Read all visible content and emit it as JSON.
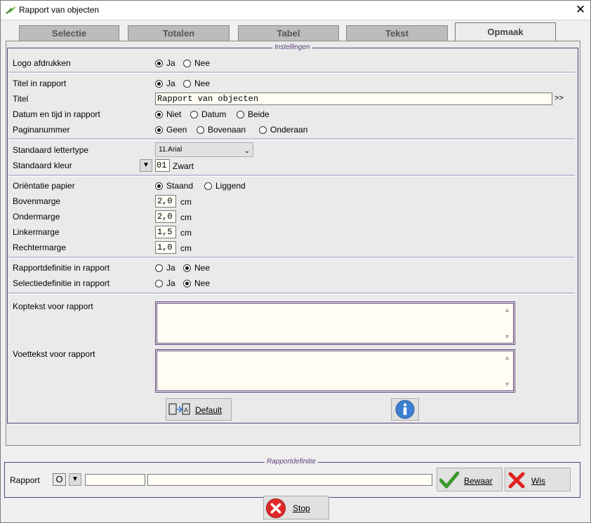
{
  "window": {
    "title": "Rapport van objecten",
    "close_glyph": "✕"
  },
  "tabs": [
    {
      "label": "Selectie"
    },
    {
      "label": "Totalen"
    },
    {
      "label": "Tabel"
    },
    {
      "label": "Tekst"
    },
    {
      "label": "Opmaak",
      "active": true
    }
  ],
  "settings": {
    "legend": "Instellingen",
    "logo": {
      "label": "Logo afdrukken",
      "options": [
        "Ja",
        "Nee"
      ],
      "selected": "Ja"
    },
    "title_in_report": {
      "label": "Titel in rapport",
      "options": [
        "Ja",
        "Nee"
      ],
      "selected": "Ja"
    },
    "title": {
      "label": "Titel",
      "value": "Rapport van objecten",
      "more": ">>"
    },
    "datetime": {
      "label": "Datum en tijd in rapport",
      "options": [
        "Niet",
        "Datum",
        "Beide"
      ],
      "selected": "Niet"
    },
    "pagenumber": {
      "label": "Paginanummer",
      "options": [
        "Geen",
        "Bovenaan",
        "Onderaan"
      ],
      "selected": "Geen"
    },
    "font": {
      "label": "Standaard lettertype",
      "value": "11.Arial"
    },
    "color": {
      "label": "Standaard kleur",
      "code": "01",
      "name": "Zwart"
    },
    "orientation": {
      "label": "Oriëntatie papier",
      "options": [
        "Staand",
        "Liggend"
      ],
      "selected": "Staand"
    },
    "margins": [
      {
        "label": "Bovenmarge",
        "value": "2,0",
        "unit": "cm"
      },
      {
        "label": "Ondermarge",
        "value": "2,0",
        "unit": "cm"
      },
      {
        "label": "Linkermarge",
        "value": "1,5",
        "unit": "cm"
      },
      {
        "label": "Rechtermarge",
        "value": "1,0",
        "unit": "cm"
      }
    ],
    "report_def": {
      "label": "Rapportdefinitie in rapport",
      "options": [
        "Ja",
        "Nee"
      ],
      "selected": "Nee"
    },
    "selection_def": {
      "label": "Selectiedefinitie in rapport",
      "options": [
        "Ja",
        "Nee"
      ],
      "selected": "Nee"
    },
    "header_text": {
      "label": "Koptekst voor rapport",
      "value": ""
    },
    "footer_text": {
      "label": "Voettekst voor rapport",
      "value": ""
    },
    "default_button": "Default"
  },
  "report_definition": {
    "legend": "Rapportdefinitie",
    "label": "Rapport",
    "code": "O",
    "field1": "",
    "field2": "",
    "save_label": "Bewaar",
    "clear_label": "Wis"
  },
  "stop_label": "Stop",
  "colors": {
    "accent": "#5a3f7a",
    "check": "#3a9a2a",
    "clear": "#e02020",
    "info": "#3c7fd0"
  }
}
